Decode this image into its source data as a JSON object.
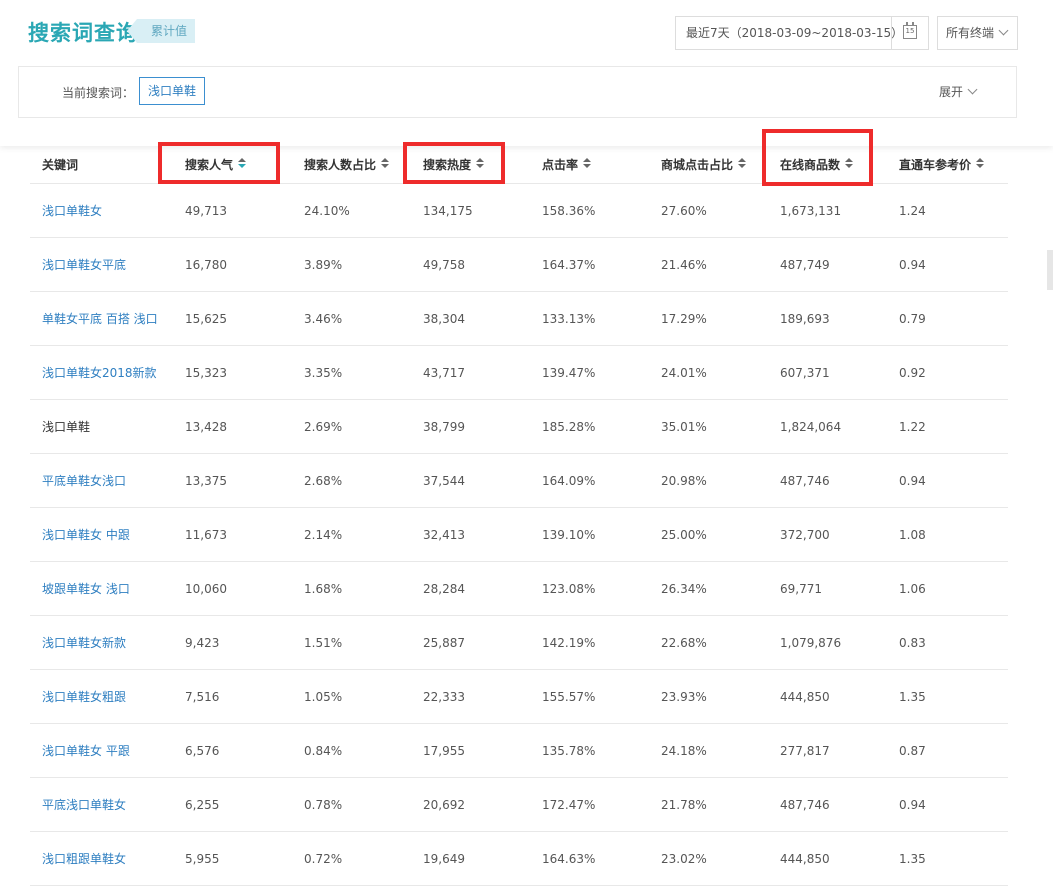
{
  "header": {
    "title": "搜索词查询",
    "badge": "累计值",
    "date_range": "最近7天（2018-03-09~2018-03-15）",
    "calendar_day": "15",
    "device": "所有终端"
  },
  "panel": {
    "current_label": "当前搜索词：",
    "current_keyword": "浅口单鞋",
    "expand_label": "展开"
  },
  "table": {
    "columns": [
      "关键词",
      "搜索人气",
      "搜索人数占比",
      "搜索热度",
      "点击率",
      "商城点击占比",
      "在线商品数",
      "直通车参考价"
    ],
    "rows": [
      {
        "kw": "浅口单鞋女",
        "link": true,
        "c1": "49,713",
        "c2": "24.10%",
        "c3": "134,175",
        "c4": "158.36%",
        "c5": "27.60%",
        "c6": "1,673,131",
        "c7": "1.24"
      },
      {
        "kw": "浅口单鞋女平底",
        "link": true,
        "c1": "16,780",
        "c2": "3.89%",
        "c3": "49,758",
        "c4": "164.37%",
        "c5": "21.46%",
        "c6": "487,749",
        "c7": "0.94"
      },
      {
        "kw": "单鞋女平底 百搭 浅口",
        "link": true,
        "c1": "15,625",
        "c2": "3.46%",
        "c3": "38,304",
        "c4": "133.13%",
        "c5": "17.29%",
        "c6": "189,693",
        "c7": "0.79"
      },
      {
        "kw": "浅口单鞋女2018新款",
        "link": true,
        "c1": "15,323",
        "c2": "3.35%",
        "c3": "43,717",
        "c4": "139.47%",
        "c5": "24.01%",
        "c6": "607,371",
        "c7": "0.92"
      },
      {
        "kw": "浅口单鞋",
        "link": false,
        "c1": "13,428",
        "c2": "2.69%",
        "c3": "38,799",
        "c4": "185.28%",
        "c5": "35.01%",
        "c6": "1,824,064",
        "c7": "1.22"
      },
      {
        "kw": "平底单鞋女浅口",
        "link": true,
        "c1": "13,375",
        "c2": "2.68%",
        "c3": "37,544",
        "c4": "164.09%",
        "c5": "20.98%",
        "c6": "487,746",
        "c7": "0.94"
      },
      {
        "kw": "浅口单鞋女 中跟",
        "link": true,
        "c1": "11,673",
        "c2": "2.14%",
        "c3": "32,413",
        "c4": "139.10%",
        "c5": "25.00%",
        "c6": "372,700",
        "c7": "1.08"
      },
      {
        "kw": "坡跟单鞋女 浅口",
        "link": true,
        "c1": "10,060",
        "c2": "1.68%",
        "c3": "28,284",
        "c4": "123.08%",
        "c5": "26.34%",
        "c6": "69,771",
        "c7": "1.06"
      },
      {
        "kw": "浅口单鞋女新款",
        "link": true,
        "c1": "9,423",
        "c2": "1.51%",
        "c3": "25,887",
        "c4": "142.19%",
        "c5": "22.68%",
        "c6": "1,079,876",
        "c7": "0.83"
      },
      {
        "kw": "浅口单鞋女粗跟",
        "link": true,
        "c1": "7,516",
        "c2": "1.05%",
        "c3": "22,333",
        "c4": "155.57%",
        "c5": "23.93%",
        "c6": "444,850",
        "c7": "1.35"
      },
      {
        "kw": "浅口单鞋女 平跟",
        "link": true,
        "c1": "6,576",
        "c2": "0.84%",
        "c3": "17,955",
        "c4": "135.78%",
        "c5": "24.18%",
        "c6": "277,817",
        "c7": "0.87"
      },
      {
        "kw": "平底浅口单鞋女",
        "link": true,
        "c1": "6,255",
        "c2": "0.78%",
        "c3": "20,692",
        "c4": "172.47%",
        "c5": "21.78%",
        "c6": "487,746",
        "c7": "0.94"
      },
      {
        "kw": "浅口粗跟单鞋女",
        "link": true,
        "c1": "5,955",
        "c2": "0.72%",
        "c3": "19,649",
        "c4": "164.63%",
        "c5": "23.02%",
        "c6": "444,850",
        "c7": "1.35"
      }
    ]
  },
  "colors": {
    "accent": "#2aa7b4",
    "link": "#2f7fc1",
    "highlight_box": "#ee2b2b"
  }
}
